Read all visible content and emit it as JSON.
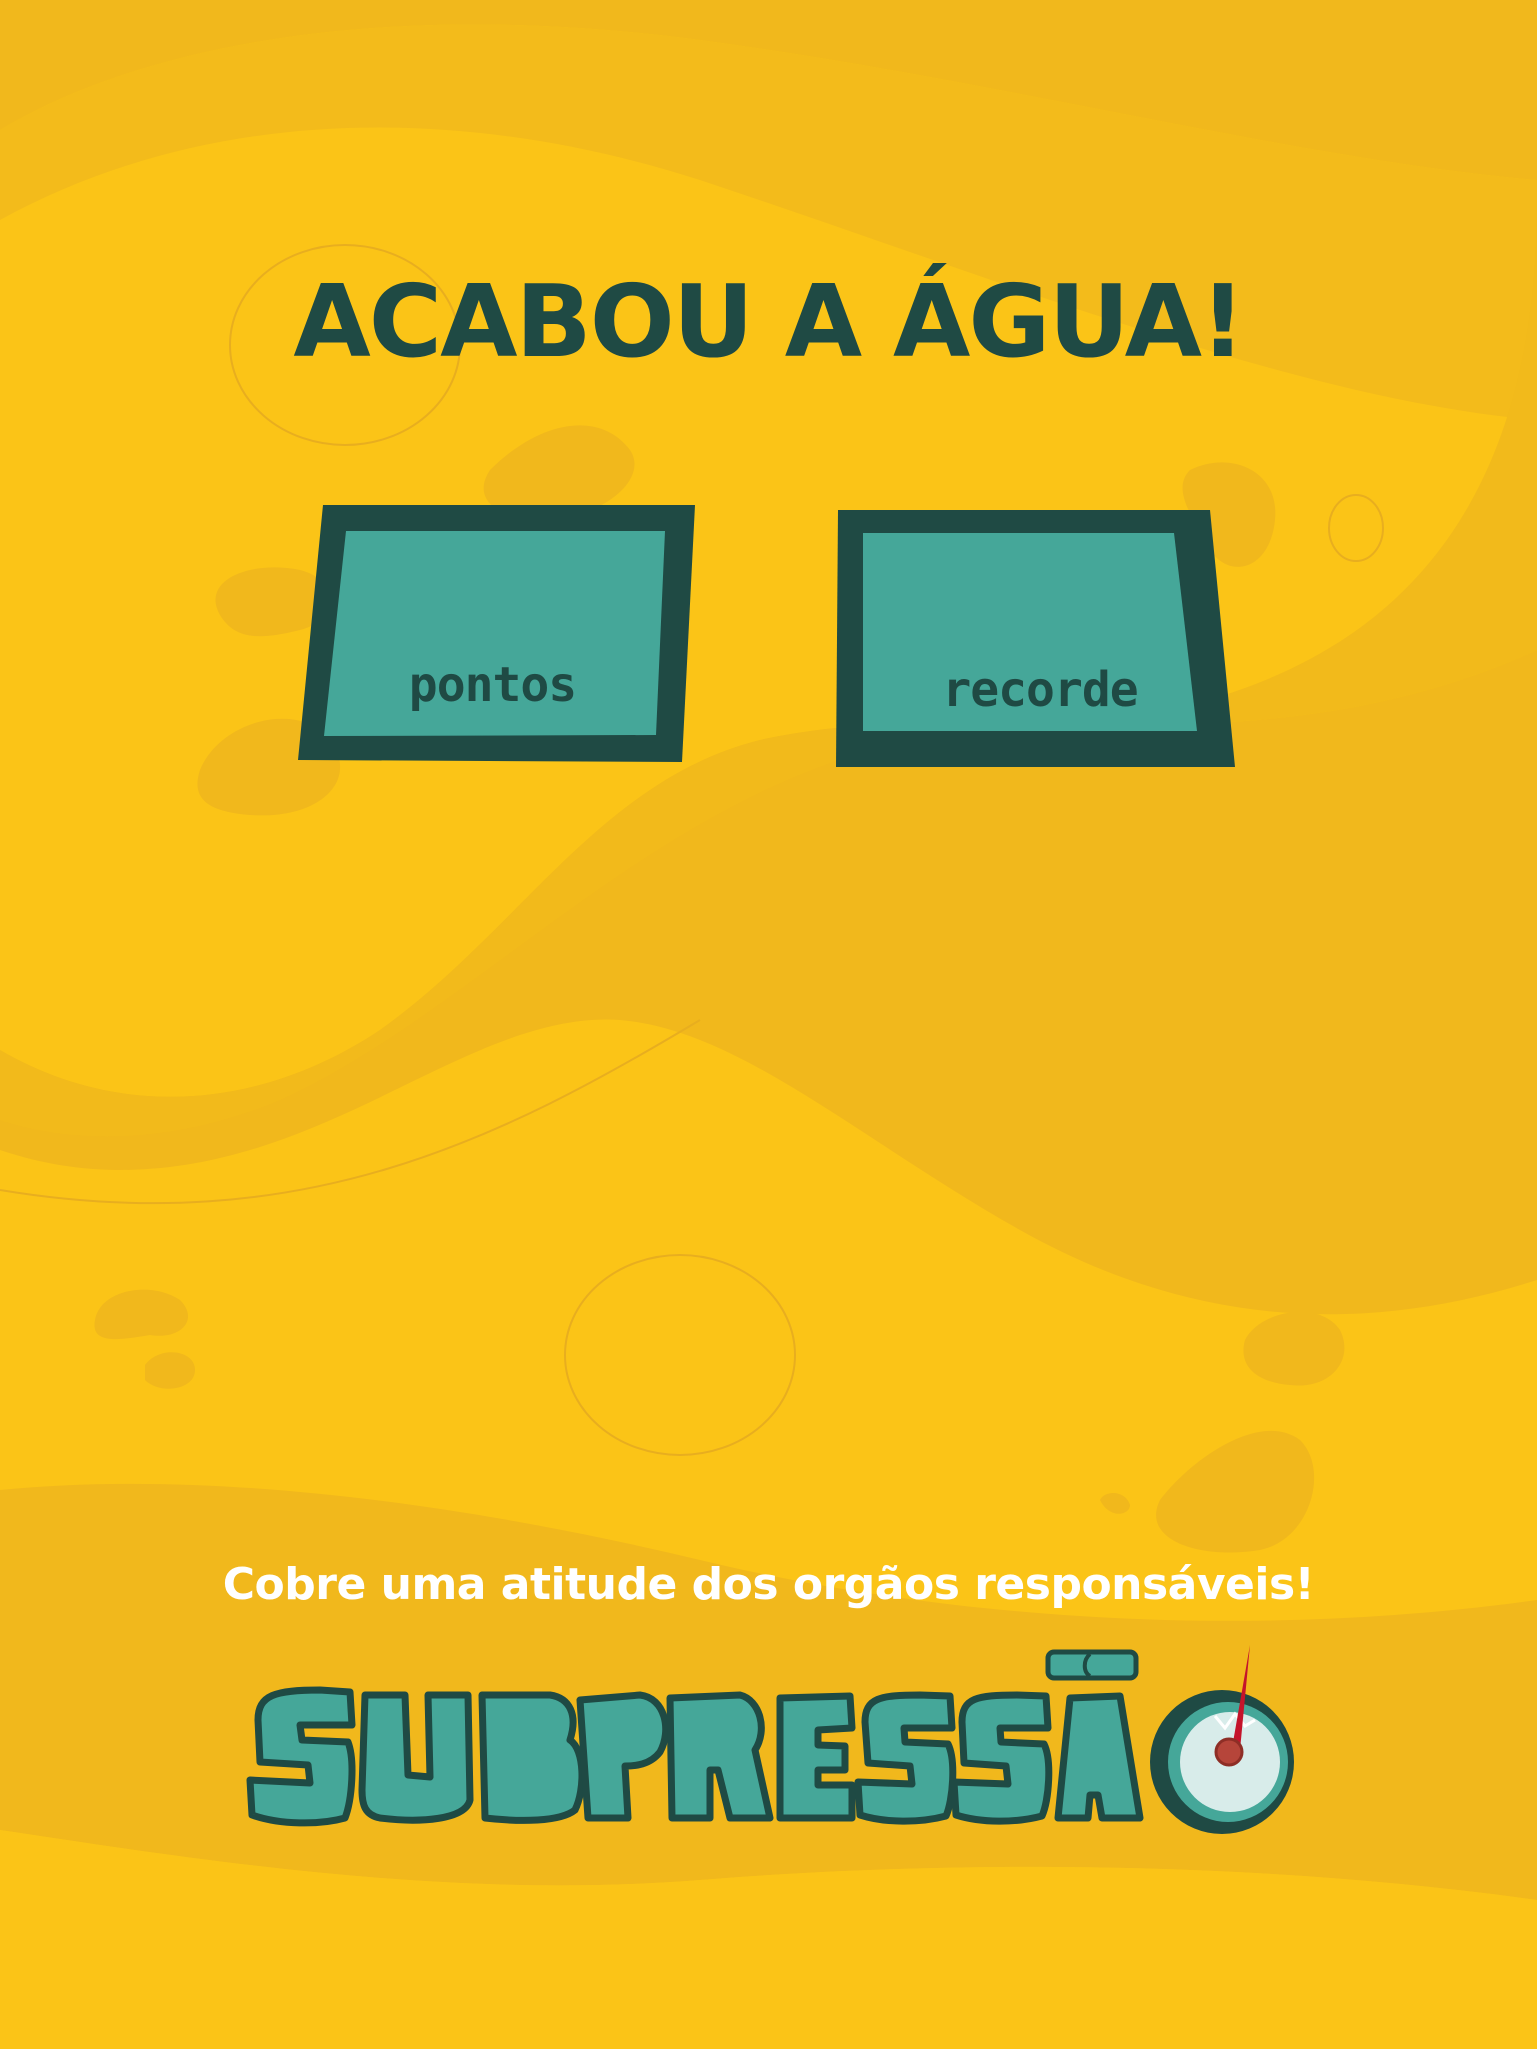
{
  "game": {
    "title": "ACABOU A ÁGUA!",
    "panels": [
      {
        "label": "pontos",
        "value": ""
      },
      {
        "label": "recorde",
        "value": ""
      }
    ],
    "call_to_action": "Cobre uma atitude dos orgãos responsáveis!",
    "logo_text": "SUBPRESSÃO"
  },
  "colors": {
    "background": "#FBC417",
    "background_dark": "#F1B81C",
    "panel_fill": "#45A799",
    "panel_border": "#1F4A44",
    "title": "#1F4A44",
    "cta_text": "#FFFFFF",
    "gauge_needle": "#C4142B",
    "gauge_face": "#D8ECEA"
  },
  "icons": {
    "gauge": "pressure-gauge-icon"
  }
}
